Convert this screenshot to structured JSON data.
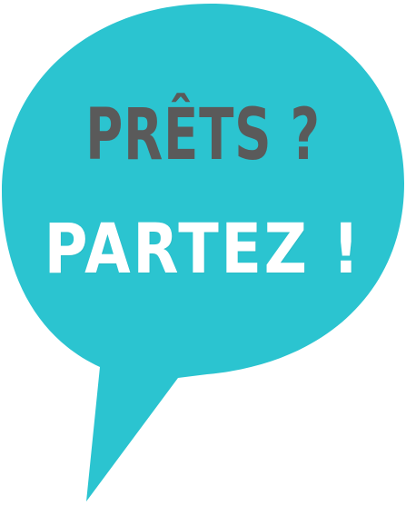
{
  "bubble": {
    "color": "#2bc4d0"
  },
  "text": {
    "line1": "PRÊTS ?",
    "line1_color": "#5a5a5a",
    "line2": "PARTEZ !",
    "line2_color": "#ffffff"
  }
}
